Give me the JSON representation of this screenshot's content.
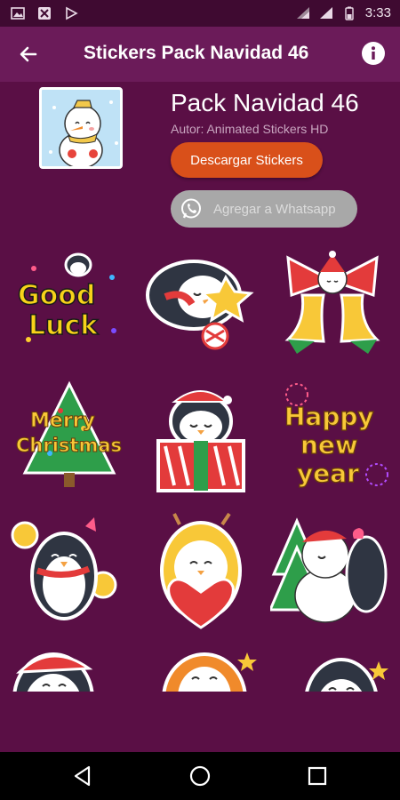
{
  "status_bar": {
    "time": "3:33",
    "left_icons": [
      "gallery-icon",
      "app-notification-icon",
      "play-store-icon"
    ],
    "right_icons": [
      "wifi-icon",
      "signal-icon",
      "battery-icon"
    ]
  },
  "app_bar": {
    "title": "Stickers Pack Navidad 46",
    "back_icon": "arrow-back-icon",
    "info_icon": "info-icon"
  },
  "pack": {
    "name": "Pack Navidad 46",
    "author": "Autor: Animated Stickers HD",
    "download_label": "Descargar Stickers",
    "whatsapp_label": "Agregar a Whatsapp",
    "tray_icon": "snowman-tray-icon"
  },
  "stickers": [
    {
      "name": "good-luck-sticker",
      "text": "Good Luck"
    },
    {
      "name": "penguin-sleeping-star-sticker",
      "text": ""
    },
    {
      "name": "christmas-bells-sticker",
      "text": ""
    },
    {
      "name": "merry-christmas-sticker",
      "text": "Merry Christmas"
    },
    {
      "name": "penguin-gift-sticker",
      "text": ""
    },
    {
      "name": "happy-new-year-sticker",
      "text": "Happy New Year"
    },
    {
      "name": "penguin-cheerleader-sticker",
      "text": ""
    },
    {
      "name": "penguin-heart-sticker",
      "text": ""
    },
    {
      "name": "snowman-penguin-kiss-sticker",
      "text": ""
    },
    {
      "name": "penguin-santa-hat-sticker",
      "text": ""
    },
    {
      "name": "penguin-hood-sticker",
      "text": ""
    },
    {
      "name": "penguin-sticker",
      "text": ""
    }
  ],
  "nav_bar": {
    "back_icon": "nav-back-icon",
    "home_icon": "nav-home-icon",
    "recents_icon": "nav-recents-icon"
  },
  "colors": {
    "background": "#5a0f45",
    "app_bar": "#6b1b59",
    "status_bar": "#3f0a31",
    "download_button": "#d9501a",
    "whatsapp_button_disabled": "#a8a8a8"
  }
}
